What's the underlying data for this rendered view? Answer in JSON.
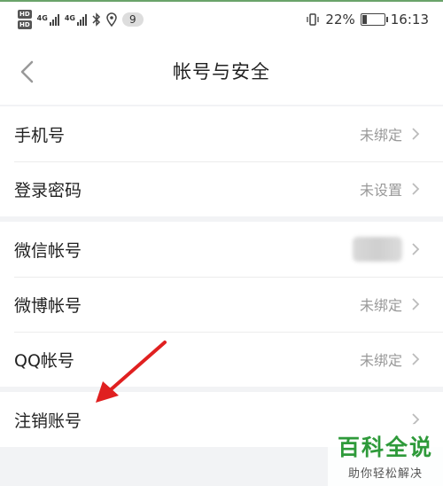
{
  "status_bar": {
    "hd_top": "HD",
    "hd_bottom": "HD",
    "net1": "4G",
    "net2": "4G",
    "notification_count": "9",
    "battery_percent": "22%",
    "battery_level": 0.22,
    "time": "16:13"
  },
  "header": {
    "title": "帐号与安全"
  },
  "groups": [
    {
      "rows": [
        {
          "label": "手机号",
          "value": "未绑定"
        },
        {
          "label": "登录密码",
          "value": "未设置"
        }
      ]
    },
    {
      "rows": [
        {
          "label": "微信帐号",
          "value": ""
        },
        {
          "label": "微博帐号",
          "value": "未绑定"
        },
        {
          "label": "QQ帐号",
          "value": "未绑定"
        }
      ]
    },
    {
      "rows": [
        {
          "label": "注销账号",
          "value": ""
        }
      ]
    }
  ],
  "colors": {
    "arrow": "#e02020",
    "watermark": "#2e9a3a"
  },
  "watermark": {
    "main": "百科全说",
    "sub": "助你轻松解决"
  }
}
